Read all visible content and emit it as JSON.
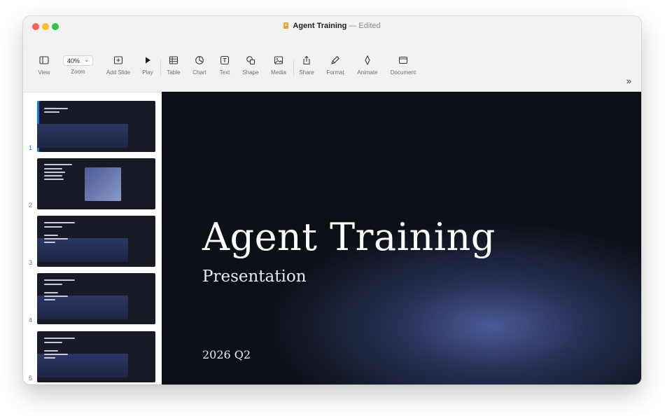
{
  "window": {
    "title": "Agent Training",
    "edited": "— Edited"
  },
  "toolbar": {
    "view": {
      "label": "View",
      "icon": "sidebar-icon"
    },
    "zoom": {
      "label": "Zoom",
      "value": "40%",
      "icon": "chevron-down-icon"
    },
    "add_slide": {
      "label": "Add Slide",
      "icon": "plus-square-icon"
    },
    "play": {
      "label": "Play",
      "icon": "play-icon"
    },
    "table": {
      "label": "Table",
      "icon": "table-icon"
    },
    "chart": {
      "label": "Chart",
      "icon": "pie-chart-icon"
    },
    "text": {
      "label": "Text",
      "icon": "text-box-icon"
    },
    "shape": {
      "label": "Shape",
      "icon": "shape-icon"
    },
    "media": {
      "label": "Media",
      "icon": "image-icon"
    },
    "share": {
      "label": "Share",
      "icon": "share-icon"
    },
    "format": {
      "label": "Format",
      "icon": "paintbrush-icon"
    },
    "animate": {
      "label": "Animate",
      "icon": "diamond-icon"
    },
    "document": {
      "label": "Document",
      "icon": "document-icon"
    },
    "more": {
      "label": "»",
      "icon": "double-chevron-right-icon"
    }
  },
  "slides": [
    {
      "number": "1",
      "active": true,
      "layout": "title"
    },
    {
      "number": "2",
      "active": false,
      "layout": "image"
    },
    {
      "number": "3",
      "active": false,
      "layout": "bullets"
    },
    {
      "number": "4",
      "active": false,
      "layout": "bullets"
    },
    {
      "number": "5",
      "active": false,
      "layout": "bullets"
    }
  ],
  "slide": {
    "title": "Agent Training",
    "subtitle": "Presentation",
    "date": "2026 Q2"
  },
  "colors": {
    "accent": "#1a73e8",
    "slide_background": "#0d0f17",
    "slide_glow": "#4e60a0",
    "title_doc_icon": "#f0a321"
  }
}
